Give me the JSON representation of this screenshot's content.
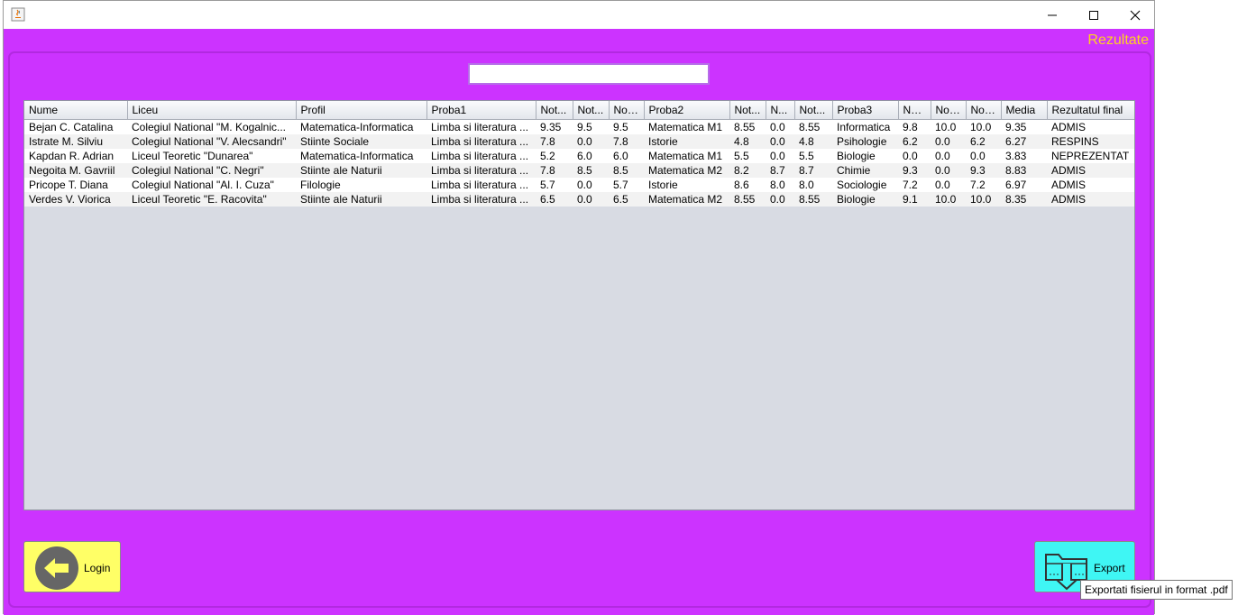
{
  "window": {
    "title": ""
  },
  "header": {
    "title": "Rezultate"
  },
  "search": {
    "value": ""
  },
  "table": {
    "columns": [
      "Nume",
      "Liceu",
      "Profil",
      "Proba1",
      "Not...",
      "Not...",
      "Not...",
      "Proba2",
      "Not...",
      "N...",
      "Not...",
      "Proba3",
      "No...",
      "Not...",
      "Not...",
      "Media",
      "Rezultatul final"
    ],
    "rows": [
      [
        "Bejan C. Catalina",
        "Colegiul National \"M. Kogalnic...",
        "Matematica-Informatica",
        "Limba si literatura ...",
        "9.35",
        "9.5",
        "9.5",
        "Matematica M1",
        "8.55",
        "0.0",
        "8.55",
        "Informatica",
        "9.8",
        "10.0",
        "10.0",
        "9.35",
        "ADMIS"
      ],
      [
        "Istrate M. Silviu",
        "Colegiul National \"V. Alecsandri\"",
        "Stiinte Sociale",
        "Limba si literatura ...",
        "7.8",
        "0.0",
        "7.8",
        "Istorie",
        "4.8",
        "0.0",
        "4.8",
        "Psihologie",
        "6.2",
        "0.0",
        "6.2",
        "6.27",
        "RESPINS"
      ],
      [
        "Kapdan R. Adrian",
        "Liceul Teoretic \"Dunarea\"",
        "Matematica-Informatica",
        "Limba si literatura ...",
        "5.2",
        "6.0",
        "6.0",
        "Matematica M1",
        "5.5",
        "0.0",
        "5.5",
        "Biologie",
        "0.0",
        "0.0",
        "0.0",
        "3.83",
        "NEPREZENTAT"
      ],
      [
        "Negoita M. Gavriil",
        "Colegiul National \"C. Negri\"",
        "Stiinte ale Naturii",
        "Limba si literatura ...",
        "7.8",
        "8.5",
        "8.5",
        "Matematica M2",
        "8.2",
        "8.7",
        "8.7",
        "Chimie",
        "9.3",
        "0.0",
        "9.3",
        "8.83",
        "ADMIS"
      ],
      [
        "Pricope T. Diana",
        "Colegiul National \"Al. I. Cuza\"",
        "Filologie",
        "Limba si literatura ...",
        "5.7",
        "0.0",
        "5.7",
        "Istorie",
        "8.6",
        "8.0",
        "8.0",
        "Sociologie",
        "7.2",
        "0.0",
        "7.2",
        "6.97",
        "ADMIS"
      ],
      [
        "Verdes V. Viorica",
        "Liceul Teoretic \"E. Racovita\"",
        "Stiinte ale Naturii",
        "Limba si literatura ...",
        "6.5",
        "0.0",
        "6.5",
        "Matematica M2",
        "8.55",
        "0.0",
        "8.55",
        "Biologie",
        "9.1",
        "10.0",
        "10.0",
        "8.35",
        "ADMIS"
      ]
    ]
  },
  "buttons": {
    "login": {
      "label": "Login",
      "icon": "arrow-left-icon"
    },
    "export": {
      "label": "Export",
      "icon": "folder-download-icon",
      "tooltip": "Exportati fisierul in format .pdf"
    }
  },
  "colors": {
    "background": "#cc33ff",
    "title": "#ffd21e",
    "login_button": "#ffff66",
    "export_button": "#3ff6f4"
  }
}
